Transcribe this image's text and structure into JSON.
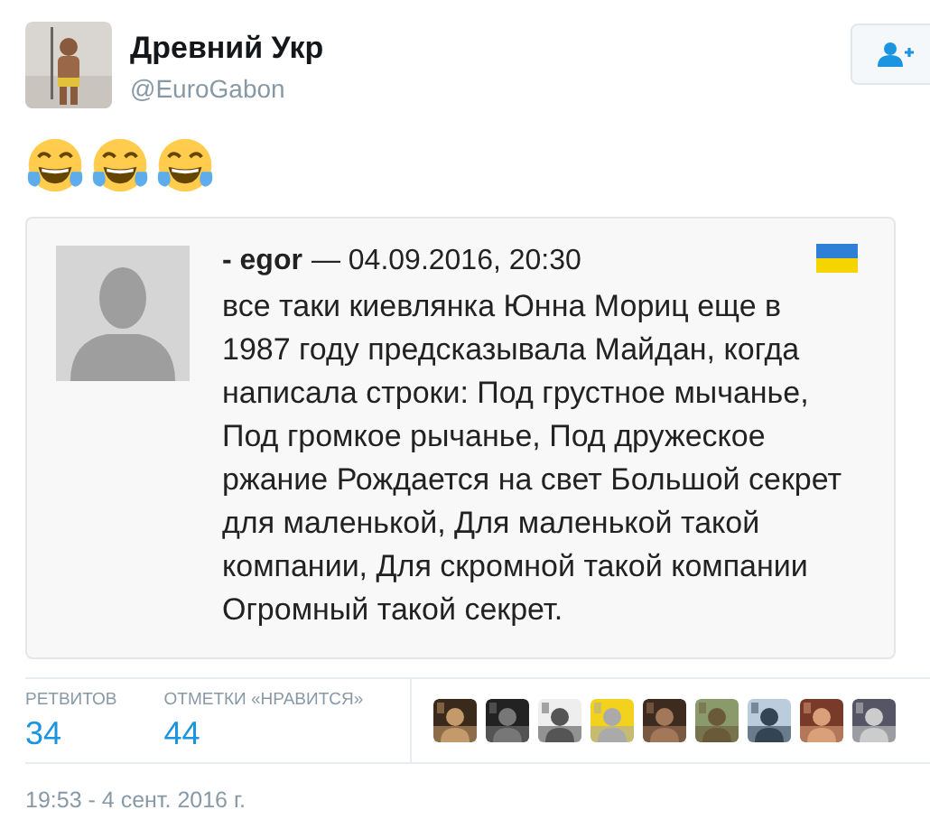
{
  "tweet": {
    "author": {
      "name": "Древний Укр",
      "handle": "@EuroGabon"
    },
    "quote": {
      "author": "- egor",
      "date": "— 04.09.2016, 20:30",
      "text": "все таки киевлянка Юнна Мориц еще в 1987 году предсказывала Майдан, когда написала строки: Под грустное мычанье, Под громкое рычанье, Под дружеское ржание Рождается на свет Большой секрет для маленькой, Для маленькой такой компании, Для скромной такой компании Огромный такой секрет."
    },
    "stats": [
      {
        "label": "РЕТВИТОВ",
        "value": "34"
      },
      {
        "label": "ОТМЕТКИ «НРАВИТСЯ»",
        "value": "44"
      }
    ],
    "timestamp": "19:53 - 4 сент. 2016 г."
  }
}
